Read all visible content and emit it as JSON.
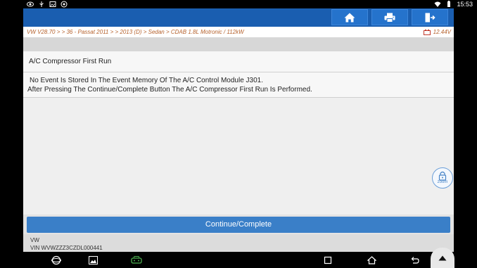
{
  "status_bar": {
    "time": "15:53",
    "left_icons": [
      "eye-icon",
      "usb-icon",
      "image-icon",
      "android-icon"
    ],
    "right_icons": [
      "wifi-icon",
      "battery-icon"
    ]
  },
  "toolbar": {
    "buttons": [
      "home-icon",
      "print-icon",
      "exit-icon"
    ]
  },
  "breadcrumb": {
    "path": "VW V28.70 > > 36 - Passat 2011 > > 2013 (D) > Sedan > CDAB 1.8L Motronic / 112kW",
    "voltage": "12.44V"
  },
  "function": {
    "title": "A/C Compressor First Run",
    "message_line1": "No Event Is Stored In The Event Memory Of The A/C Control Module J301.",
    "message_line2": "After Pressing The Continue/Complete Button The A/C Compressor First Run Is Performed."
  },
  "zoom": {
    "label": "zoom"
  },
  "actions": {
    "continue_label": "Continue/Complete"
  },
  "vehicle": {
    "make": "VW",
    "vin": "VIN WVWZZZ3CZDL000441"
  },
  "colors": {
    "toolbar": "#1a5eb0",
    "accent_button": "#3a7fc8",
    "breadcrumb_text": "#b5612c"
  }
}
